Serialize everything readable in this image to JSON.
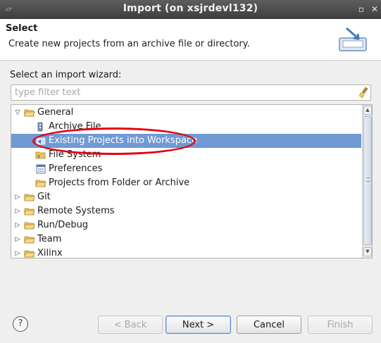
{
  "window": {
    "title": "Import  (on xsjrdevl132)",
    "minimize_glyph": "▫",
    "close_glyph": "✕"
  },
  "banner": {
    "heading": "Select",
    "description": "Create new projects from an archive file or directory."
  },
  "wizard_label": "Select an import wizard:",
  "filter": {
    "value": "",
    "placeholder": "type filter text"
  },
  "tree": {
    "items": [
      {
        "label": "General",
        "icon": "folder-icon",
        "expanded": true,
        "level": 0
      },
      {
        "label": "Archive File",
        "icon": "archive-icon",
        "level": 1
      },
      {
        "label": "Existing Projects into Workspace",
        "icon": "project-icon",
        "level": 1,
        "selected": true
      },
      {
        "label": "File System",
        "icon": "folder-icon",
        "level": 1
      },
      {
        "label": "Preferences",
        "icon": "preferences-icon",
        "level": 1
      },
      {
        "label": "Projects from Folder or Archive",
        "icon": "folder-icon",
        "level": 1
      },
      {
        "label": "Git",
        "icon": "folder-icon",
        "expanded": false,
        "level": 0
      },
      {
        "label": "Remote Systems",
        "icon": "folder-icon",
        "expanded": false,
        "level": 0
      },
      {
        "label": "Run/Debug",
        "icon": "folder-icon",
        "expanded": false,
        "level": 0
      },
      {
        "label": "Team",
        "icon": "folder-icon",
        "expanded": false,
        "level": 0
      },
      {
        "label": "Xilinx",
        "icon": "folder-icon",
        "expanded": false,
        "level": 0
      }
    ]
  },
  "footer": {
    "help_glyph": "?",
    "back_label": "< Back",
    "next_label": "Next >",
    "cancel_label": "Cancel",
    "finish_label": "Finish"
  },
  "colors": {
    "selection": "#6f9ad4",
    "annotation": "#e3000f",
    "titlebar": "#4a4a4a"
  }
}
